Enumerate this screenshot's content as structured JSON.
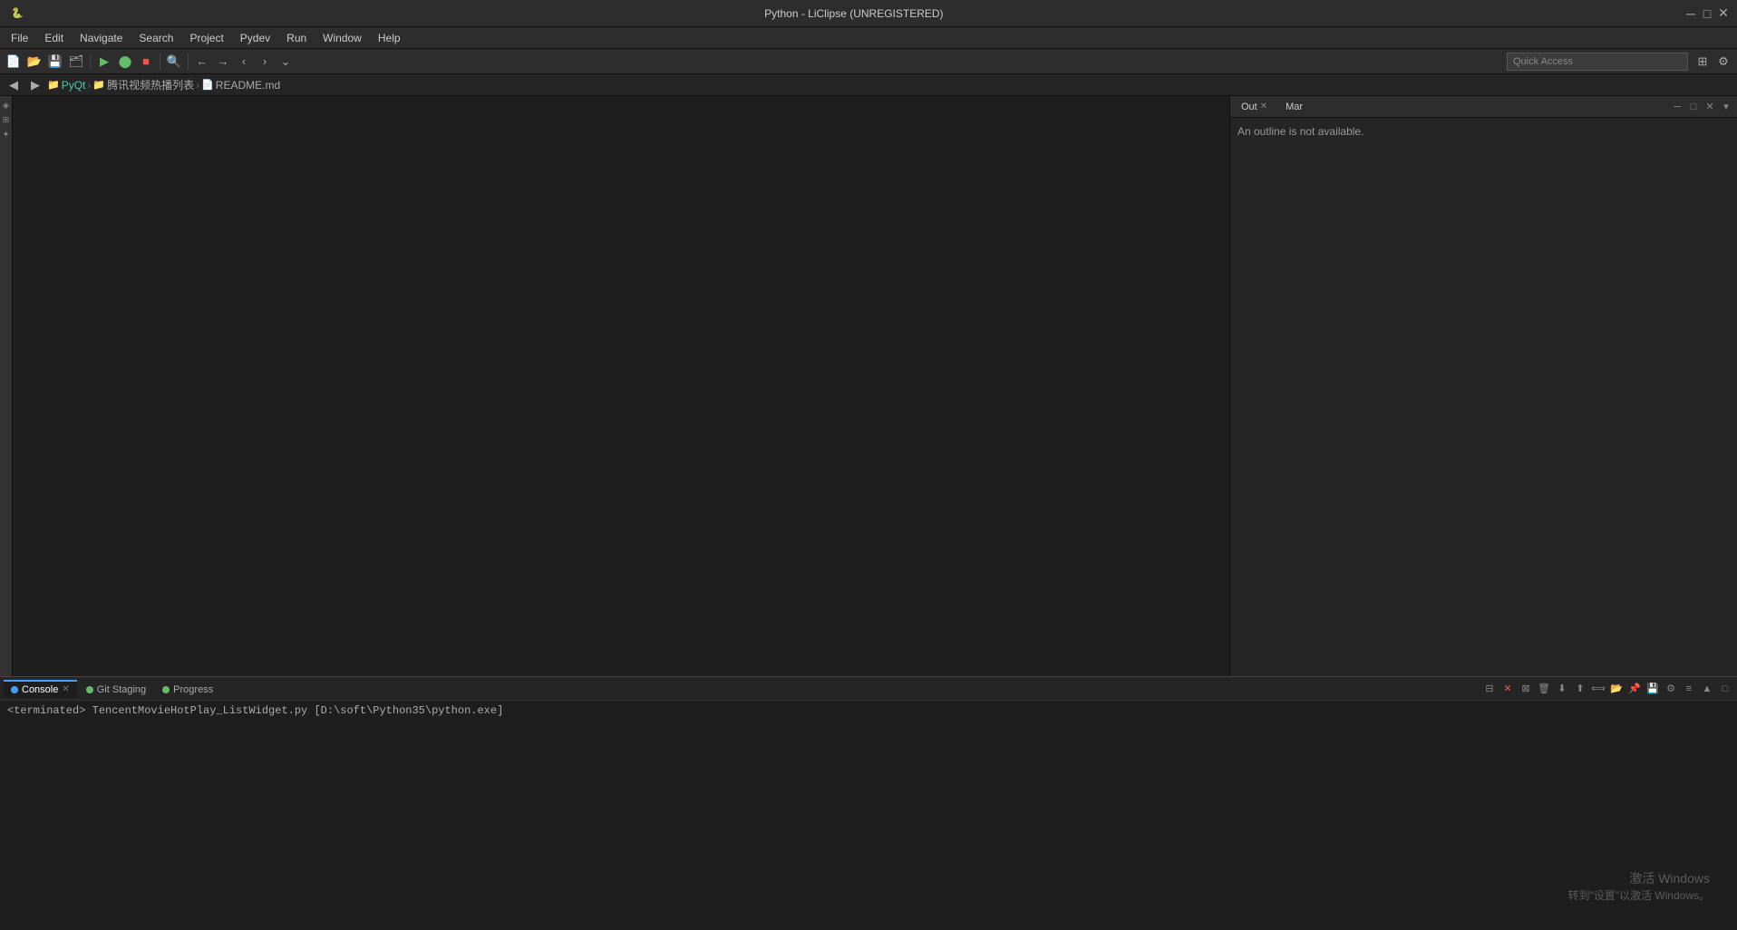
{
  "titlebar": {
    "title": "Python - LiClipse (UNREGISTERED)",
    "minimize": "─",
    "maximize": "□",
    "close": "✕"
  },
  "menubar": {
    "items": [
      "File",
      "Edit",
      "Navigate",
      "Search",
      "Project",
      "Pydev",
      "Run",
      "Window",
      "Help"
    ]
  },
  "toolbar": {
    "quick_access_placeholder": "Quick Access"
  },
  "breadcrumb": {
    "parts": [
      "PyQt",
      "腾讯视频热播列表",
      "README.md"
    ]
  },
  "right_panel": {
    "tab1_label": "Out",
    "tab2_label": "Mar",
    "outline_message": "An outline is not available."
  },
  "bottom_panel": {
    "console_tab": "Console",
    "git_staging_tab": "Git Staging",
    "progress_tab": "Progress",
    "terminated_text": "<terminated> TencentMovieHotPlay_ListWidget.py [D:\\soft\\Python35\\python.exe]"
  },
  "watermark": {
    "line1": "激活 Windows",
    "line2": "转到\"设置\"以激活 Windows。"
  },
  "icons": {
    "new_file": "📄",
    "open": "📂",
    "save": "💾",
    "search": "🔍",
    "run": "▶",
    "debug": "🐛",
    "back": "←",
    "forward": "→",
    "refresh": "↻"
  }
}
